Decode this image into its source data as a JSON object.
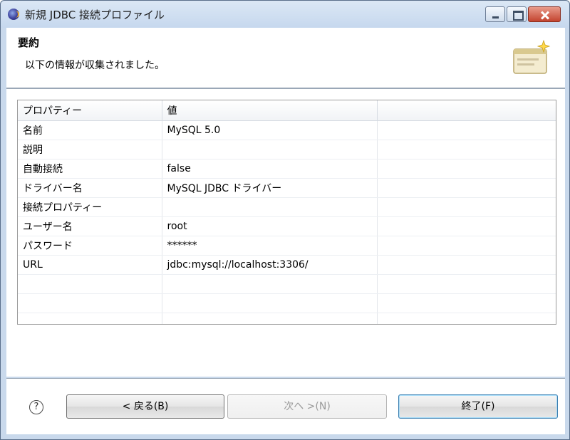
{
  "window": {
    "title": "新規 JDBC 接続プロファイル"
  },
  "header": {
    "title": "要約",
    "description": "以下の情報が収集されました。"
  },
  "table": {
    "columns": [
      "プロパティー",
      "値",
      ""
    ],
    "rows": [
      [
        "名前",
        "MySQL 5.0"
      ],
      [
        "説明",
        ""
      ],
      [
        "自動接続",
        "false"
      ],
      [
        "ドライバー名",
        "MySQL JDBC ドライバー"
      ],
      [
        "接続プロパティー",
        ""
      ],
      [
        "ユーザー名",
        "root"
      ],
      [
        "パスワード",
        "******"
      ],
      [
        "URL",
        "jdbc:mysql://localhost:3306/"
      ],
      [
        "",
        ""
      ],
      [
        "",
        ""
      ],
      [
        "",
        ""
      ]
    ]
  },
  "buttons": {
    "help": "?",
    "back": "< 戻る(B)",
    "next": "次へ >(N)",
    "finish": "終了(F)"
  }
}
